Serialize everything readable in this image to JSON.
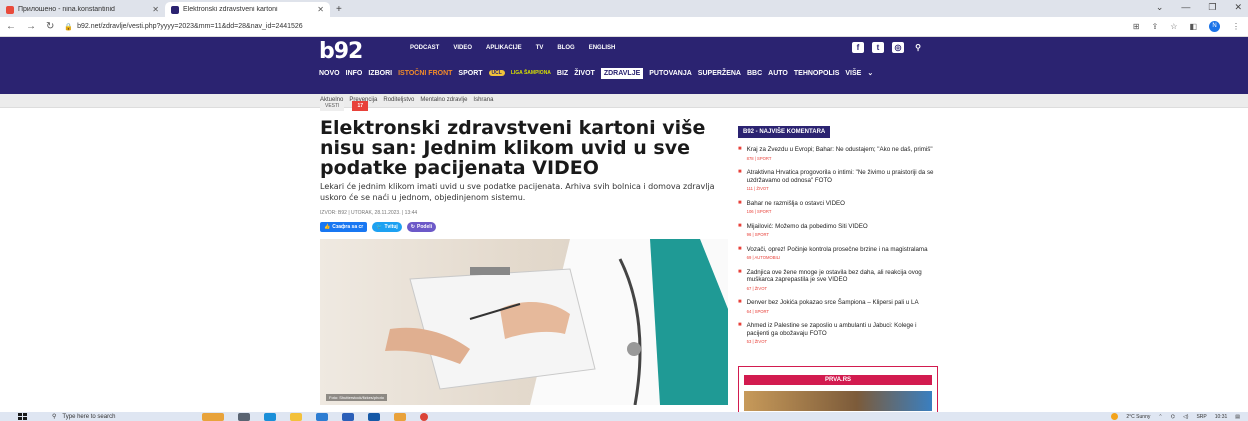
{
  "browser": {
    "tabs": [
      {
        "title": "Прилошено - nina.konstantinid",
        "color": "#e94b3c",
        "active": false
      },
      {
        "title": "Elektronski zdravstveni kartoni",
        "color": "#2b2371",
        "active": true
      }
    ],
    "new_tab": "+",
    "url": "b92.net/zdravlje/vesti.php?yyyy=2023&mm=11&dd=28&nav_id=2441526",
    "profile_initial": "N"
  },
  "site": {
    "logo": "b92",
    "topnav": [
      "PODCAST",
      "VIDEO",
      "APLIKACIJE",
      "TV",
      "BLOG",
      "ENGLISH"
    ],
    "mainnav": [
      "NOVO",
      "INFO",
      "IZBORI",
      "ISTOČNI FRONT",
      "SPORT",
      "LIGA ŠAMPIONA",
      "BIZ",
      "ŽIVOT",
      "ZDRAVLJE",
      "PUTOVANJA",
      "SUPERŽENA",
      "BBC",
      "AUTO",
      "TEHNOPOLIS",
      "VIŠE"
    ],
    "subnav": [
      "Aktuelno",
      "Prevencija",
      "Roditeljstvo",
      "Mentalno zdravlje",
      "Ishrana"
    ]
  },
  "article": {
    "tag": "VESTI",
    "comment_count": "17",
    "headline": "Elektronski zdravstveni kartoni više nisu san: Jednim klikom uvid u sve podatke pacijenata VIDEO",
    "lead": "Lekari će jednim klikom imati uvid u sve podatke pacijenata. Arhiva svih bolnica i domova zdravlja uskoro će se naći u jednom, objedinjenom sistemu.",
    "byline": "IZVOR: B92 | UTORAK, 28.11.2023. | 13:44",
    "share": {
      "facebook": "Сзафrа sa cr",
      "twitter": "Tvituj",
      "podeli": "Podeli"
    },
    "photo_caption": "Foto: Shutterstock/fizkes/photo"
  },
  "sidebar": {
    "title": "B92 - NAJVIŠE KOMENTARA",
    "items": [
      {
        "text": "Kraj za Zvezdu u Evropi; Bahar: Ne odustajem; \"Ako ne daš, primiš\"",
        "meta": "878 | SPORT"
      },
      {
        "text": "Atraktivna Hrvatica progovorila o intimi: \"Ne živimo u praistoriji da se uzdržavamo od odnosa\" FOTO",
        "meta": "111 | ŽIVOT"
      },
      {
        "text": "Bahar ne razmišlja o ostavci VIDEO",
        "meta": "106 | SPORT"
      },
      {
        "text": "Mijailović: Možemo da pobedimo Siti VIDEO",
        "meta": "96 | SPORT"
      },
      {
        "text": "Vozači, oprez! Počinje kontrola prosečne brzine i na magistralama",
        "meta": "69 | AUTOMOBILI"
      },
      {
        "text": "Zadnjica ove žene mnoge je ostavila bez daha, ali reakcija ovog muškarca zaprepastila je sve VIDEO",
        "meta": "67 | ŽIVOT"
      },
      {
        "text": "Denver bez Jokića pokazao srce Šampiona – Klipersi pali u LA",
        "meta": "64 | SPORT"
      },
      {
        "text": "Ahmed iz Palestine se zaposlio u ambulanti u Jabuci: Kolege i pacijenti ga obožavaju FOTO",
        "meta": "53 | ŽIVOT"
      }
    ],
    "prva_title": "PRVA.RS"
  },
  "taskbar": {
    "search_placeholder": "Type here to search",
    "weather": "2°C Sunny",
    "lang": "SRP",
    "time": "10:31"
  }
}
